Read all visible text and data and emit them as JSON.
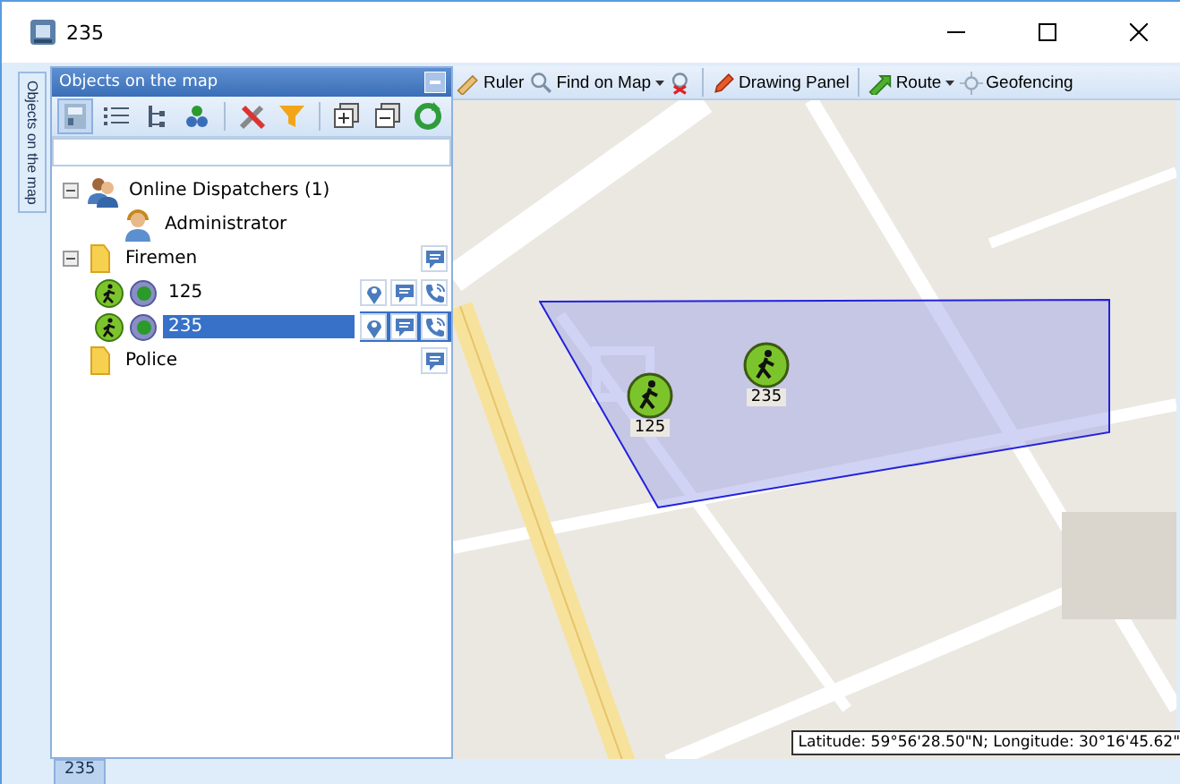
{
  "window": {
    "title": "235"
  },
  "side_tab": {
    "label": "Objects on the map"
  },
  "panel": {
    "title": "Objects on the map",
    "toolbar": [
      {
        "kind": "tool",
        "selected": true
      },
      {
        "kind": "tool",
        "selected": false
      },
      {
        "kind": "tool",
        "selected": false
      },
      {
        "kind": "tool",
        "selected": false
      },
      {
        "kind": "separator"
      },
      {
        "kind": "tool",
        "selected": false
      },
      {
        "kind": "tool",
        "selected": false
      },
      {
        "kind": "separator"
      },
      {
        "kind": "tool",
        "selected": false
      },
      {
        "kind": "tool",
        "selected": false
      },
      {
        "kind": "tool",
        "selected": false
      }
    ],
    "tree": [
      {
        "kind": "dispatchers",
        "label": "Online Dispatchers (1)",
        "expanded": true,
        "selected": false,
        "children": [
          {
            "kind": "dispatcher",
            "label": "Administrator",
            "selected": false
          }
        ]
      },
      {
        "kind": "group",
        "label": "Firemen",
        "expanded": true,
        "selected": false,
        "children": [
          {
            "kind": "unit",
            "label": "125",
            "selected": false
          },
          {
            "kind": "unit",
            "label": "235",
            "selected": true
          }
        ]
      },
      {
        "kind": "group",
        "label": "Police",
        "selected": false
      }
    ]
  },
  "map_toolbar": [
    {
      "kind": "ruler",
      "label": "Ruler"
    },
    {
      "kind": "find",
      "label": "Find on Map",
      "dropdown": true
    },
    {
      "kind": "clear"
    },
    {
      "kind": "separator"
    },
    {
      "kind": "draw",
      "label": "Drawing Panel"
    },
    {
      "kind": "separator"
    },
    {
      "kind": "route",
      "label": "Route",
      "dropdown": true
    },
    {
      "kind": "geofence",
      "label": "Geofencing"
    }
  ],
  "map": {
    "markers": [
      {
        "label": "125"
      },
      {
        "label": "235"
      }
    ],
    "coordinates": "Latitude: 59°56'28.50\"N; Longitude: 30°16'45.62\""
  },
  "bottom_tabs": [
    {
      "label": "235",
      "selected": true
    }
  ]
}
